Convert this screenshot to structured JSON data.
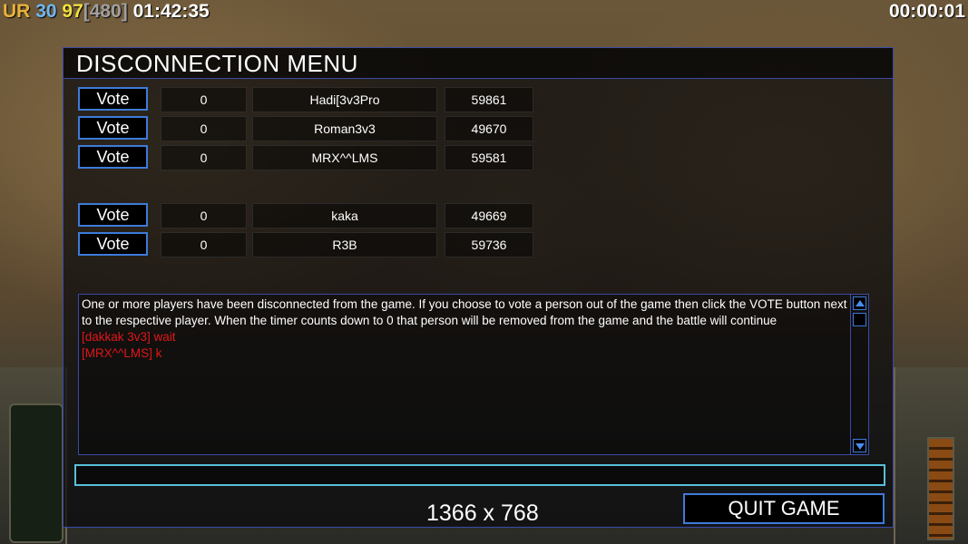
{
  "hud": {
    "ur_label": "UR",
    "val1": "30",
    "val2": "97",
    "val3": "[480]",
    "clock": "01:42:35",
    "timer": "00:00:01"
  },
  "dialog": {
    "title": "DISCONNECTION MENU",
    "vote_label": "Vote",
    "players": [
      {
        "votes": "0",
        "name": "Hadi[3v3Pro",
        "ping": "59861"
      },
      {
        "votes": "0",
        "name": "Roman3v3",
        "ping": "49670"
      },
      {
        "votes": "0",
        "name": "MRX^^LMS",
        "ping": "59581"
      },
      {
        "votes": "0",
        "name": "kaka",
        "ping": "49669"
      },
      {
        "votes": "0",
        "name": "R3B",
        "ping": "59736"
      }
    ],
    "message": "One or more players have been disconnected from the game. If you choose to vote a person out of the game then click the VOTE button next to the respective player. When the timer counts down to 0 that person will be removed from the game and the battle will continue",
    "chat_lines": [
      "[dakkak 3v3] wait",
      "[MRX^^LMS] k"
    ],
    "chat_input_value": "",
    "resolution": "1366 x 768",
    "quit_label": "QUIT GAME"
  },
  "colors": {
    "accent_blue": "#3d7bd9",
    "chat_red": "#e0161a",
    "input_border": "#58c0d8",
    "ur_color": "#e8b23a",
    "val1_color": "#6fb6f0",
    "val2_color": "#f0e040",
    "val3_color": "#a0a0a0"
  }
}
